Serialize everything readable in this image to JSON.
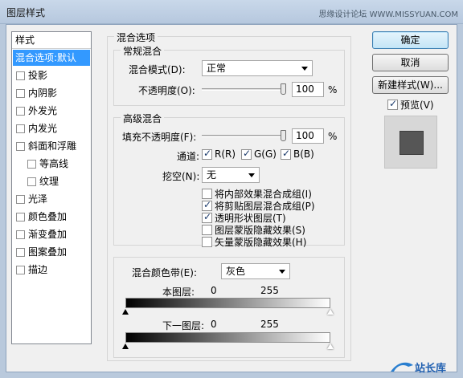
{
  "window": {
    "title": "图层样式",
    "watermark": "思缘设计论坛 WWW.MISSYUAN.COM"
  },
  "left_panel": {
    "header": "样式",
    "items": [
      {
        "label": "混合选项:默认",
        "selected": true
      },
      {
        "label": "投影"
      },
      {
        "label": "内阴影"
      },
      {
        "label": "外发光"
      },
      {
        "label": "内发光"
      },
      {
        "label": "斜面和浮雕"
      },
      {
        "label": "等高线"
      },
      {
        "label": "纹理"
      },
      {
        "label": "光泽"
      },
      {
        "label": "颜色叠加"
      },
      {
        "label": "渐变叠加"
      },
      {
        "label": "图案叠加"
      },
      {
        "label": "描边"
      }
    ]
  },
  "blend_options": {
    "title": "混合选项",
    "general": {
      "title": "常规混合",
      "mode_label": "混合模式(D):",
      "mode_value": "正常",
      "opacity_label": "不透明度(O):",
      "opacity_value": "100",
      "percent": "%",
      "opacity_level": 1.0
    },
    "advanced": {
      "title": "高级混合",
      "fill_label": "填充不透明度(F):",
      "fill_value": "100",
      "percent": "%",
      "fill_level": 1.0,
      "channels_label": "通道:",
      "channels": [
        {
          "label": "R(R)",
          "checked": true
        },
        {
          "label": "G(G)",
          "checked": true
        },
        {
          "label": "B(B)",
          "checked": true
        }
      ],
      "knockout_label": "挖空(N):",
      "knockout_value": "无",
      "options": [
        {
          "label": "将内部效果混合成组(I)",
          "checked": false
        },
        {
          "label": "将剪贴图层混合成组(P)",
          "checked": true
        },
        {
          "label": "透明形状图层(T)",
          "checked": true
        },
        {
          "label": "图层蒙版隐藏效果(S)",
          "checked": false
        },
        {
          "label": "矢量蒙版隐藏效果(H)",
          "checked": false
        }
      ]
    },
    "blend_if": {
      "label": "混合颜色带(E):",
      "value": "灰色",
      "this_layer_label": "本图层:",
      "this_layer_low": "0",
      "this_layer_high": "255",
      "under_layer_label": "下一图层:",
      "under_layer_low": "0",
      "under_layer_high": "255"
    }
  },
  "buttons": {
    "ok": "确定",
    "cancel": "取消",
    "new_style": "新建样式(W)...",
    "preview_label": "预览(V)",
    "preview_checked": true
  },
  "logo_text": "站长库"
}
